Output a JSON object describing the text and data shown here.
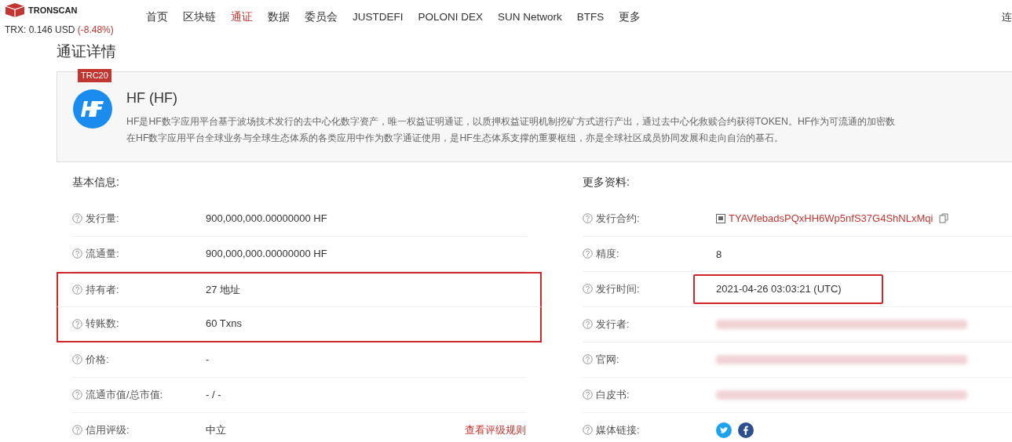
{
  "header": {
    "brand": "TRONSCAN",
    "price": "TRX: 0.146 USD",
    "change": "(-8.48%)",
    "nav": [
      {
        "label": "首页",
        "selected": false
      },
      {
        "label": "区块链",
        "selected": false
      },
      {
        "label": "通证",
        "selected": true
      },
      {
        "label": "数据",
        "selected": false
      },
      {
        "label": "委员会",
        "selected": false
      },
      {
        "label": "JUSTDEFI",
        "selected": false
      },
      {
        "label": "POLONI DEX",
        "selected": false
      },
      {
        "label": "SUN Network",
        "selected": false
      },
      {
        "label": "BTFS",
        "selected": false
      },
      {
        "label": "更多",
        "selected": false
      }
    ],
    "right_cut": "连"
  },
  "page_title": "通证详情",
  "token": {
    "badge": "TRC20",
    "name": "HF (HF)",
    "description": [
      "HF是HF数字应用平台基于波场技术发行的去中心化数字资产，唯一权益证明通证，以质押权益证明机制挖矿方式进行产出，通过去中心化救赎合约获得TOKEN。HF作为可流通的加密数",
      "在HF数字应用平台全球业务与全球生态体系的各类应用中作为数字通证使用，是HF生态体系支撑的重要枢纽，亦是全球社区成员协同发展和走向自治的基石。"
    ]
  },
  "basic": {
    "title": "基本信息:",
    "rows": [
      {
        "label": "发行量:",
        "value": "900,000,000.00000000 HF",
        "highlighted": false
      },
      {
        "label": "流通量:",
        "value": "900,000,000.00000000 HF",
        "highlighted": false
      },
      {
        "label": "持有者:",
        "value": "27 地址",
        "highlighted": true
      },
      {
        "label": "转账数:",
        "value": "60 Txns",
        "highlighted": true
      },
      {
        "label": "价格:",
        "value": "-",
        "highlighted": false
      },
      {
        "label": "流通市值/总市值:",
        "value": "- / -",
        "highlighted": false
      },
      {
        "label": "信用评级:",
        "value": "中立",
        "link": "查看评级规则",
        "highlighted": false
      }
    ]
  },
  "more": {
    "title": "更多资料:",
    "rows": [
      {
        "kind": "contract",
        "label": "发行合约:",
        "value": "TYAVfebadsPQxHH6Wp5nfS37G4ShNLxMqi",
        "highlighted": false
      },
      {
        "kind": "text",
        "label": "精度:",
        "value": "8",
        "highlighted": false
      },
      {
        "kind": "text",
        "label": "发行时间:",
        "value": "2021-04-26 03:03:21 (UTC)",
        "highlighted": true
      },
      {
        "kind": "redacted",
        "label": "发行者:",
        "highlighted": false
      },
      {
        "kind": "redacted",
        "label": "官网:",
        "highlighted": false
      },
      {
        "kind": "redacted",
        "label": "白皮书:",
        "highlighted": false
      },
      {
        "kind": "social",
        "label": "媒体链接:",
        "highlighted": false
      }
    ]
  }
}
